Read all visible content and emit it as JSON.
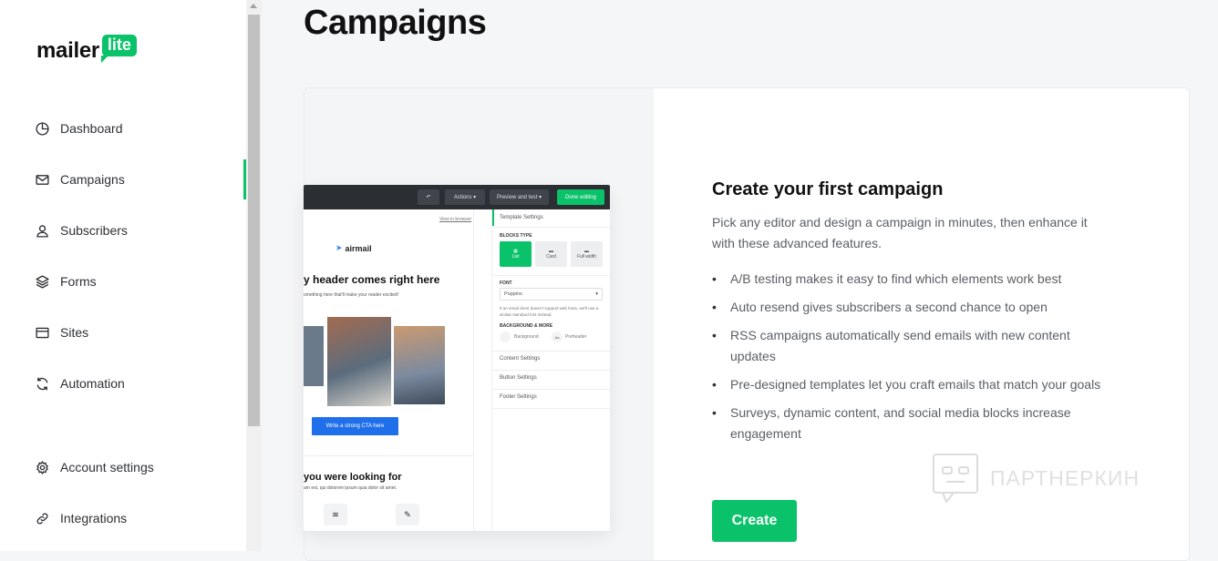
{
  "brand": {
    "word": "mailer",
    "badge": "lite",
    "accent": "#09c269"
  },
  "sidebar": {
    "items": [
      {
        "label": "Dashboard",
        "icon": "dashboard-icon"
      },
      {
        "label": "Campaigns",
        "icon": "mail-icon",
        "active": true
      },
      {
        "label": "Subscribers",
        "icon": "user-icon"
      },
      {
        "label": "Forms",
        "icon": "layers-icon"
      },
      {
        "label": "Sites",
        "icon": "browser-icon"
      },
      {
        "label": "Automation",
        "icon": "refresh-icon"
      }
    ],
    "bottom_items": [
      {
        "label": "Account settings",
        "icon": "gear-icon"
      },
      {
        "label": "Integrations",
        "icon": "link-icon"
      }
    ]
  },
  "page": {
    "title": "Campaigns"
  },
  "preview": {
    "toolbar": {
      "actions": "Actions ▾",
      "preview": "Preview and test ▾",
      "done": "Done editing"
    },
    "email": {
      "view_in_browser": "View in browser",
      "brand": "airmail",
      "headline": "y header comes right here",
      "subline": "omething here that'll make your reader excited!",
      "cta": "Write a strong CTA here",
      "section_title": "you were looking for",
      "section_text": "am est, qui dolorem ipsum quia dolor sit amet."
    },
    "panel": {
      "template_settings": "Template Settings",
      "blocks_type": "BLOCKS TYPE",
      "block_options": [
        "List",
        "Card",
        "Full width"
      ],
      "font_label": "FONT",
      "font_value": "Poppins",
      "font_note": "If an email client doesn't support web fonts, we'll use a similar standard font instead.",
      "bg_label": "BACKGROUND & MORE",
      "bg_option1": "Background",
      "bg_option2": "Preheader",
      "bg_swatch2": "Aa",
      "sections": [
        "Content Settings",
        "Button Settings",
        "Footer Settings"
      ]
    }
  },
  "onboarding": {
    "heading": "Create your first campaign",
    "description": "Pick any editor and design a campaign in minutes, then enhance it with these advanced features.",
    "features": [
      "A/B testing makes it easy to find which elements work best",
      "Auto resend gives subscribers a second chance to open",
      "RSS campaigns automatically send emails with new content updates",
      "Pre-designed templates let you craft emails that match your goals",
      "Surveys, dynamic content, and social media blocks increase engagement"
    ],
    "button": "Create"
  },
  "watermark": {
    "text": "ПАРТНЕРКИН"
  }
}
